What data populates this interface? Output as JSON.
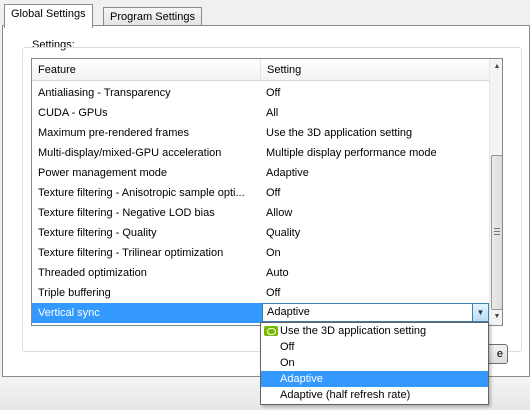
{
  "tabs": [
    {
      "label": "Global Settings",
      "active": true
    },
    {
      "label": "Program Settings",
      "active": false
    }
  ],
  "settings_label": "Settings:",
  "table": {
    "headers": {
      "feature": "Feature",
      "setting": "Setting"
    },
    "rows": [
      {
        "feature": "Antialiasing - Transparency",
        "setting": "Off"
      },
      {
        "feature": "CUDA - GPUs",
        "setting": "All"
      },
      {
        "feature": "Maximum pre-rendered frames",
        "setting": "Use the 3D application setting"
      },
      {
        "feature": "Multi-display/mixed-GPU acceleration",
        "setting": "Multiple display performance mode"
      },
      {
        "feature": "Power management mode",
        "setting": "Adaptive"
      },
      {
        "feature": "Texture filtering - Anisotropic sample opti...",
        "setting": "Off"
      },
      {
        "feature": "Texture filtering - Negative LOD bias",
        "setting": "Allow"
      },
      {
        "feature": "Texture filtering - Quality",
        "setting": "Quality"
      },
      {
        "feature": "Texture filtering - Trilinear optimization",
        "setting": "On"
      },
      {
        "feature": "Threaded optimization",
        "setting": "Auto"
      },
      {
        "feature": "Triple buffering",
        "setting": "Off"
      },
      {
        "feature": "Vertical sync",
        "setting": ""
      }
    ],
    "selected_row": 11
  },
  "combo": {
    "value": "Adaptive",
    "arrow": "▼"
  },
  "dropdown_options": [
    "Use the 3D application setting",
    "Off",
    "On",
    "Adaptive",
    "Adaptive (half refresh rate)"
  ],
  "highlighted_option": 3,
  "scrollbar": {
    "up": "▲",
    "down": "▼"
  },
  "partial_button_text": "e",
  "colors": {
    "selection": "#3399ff",
    "nvidia_green": "#76b900"
  }
}
